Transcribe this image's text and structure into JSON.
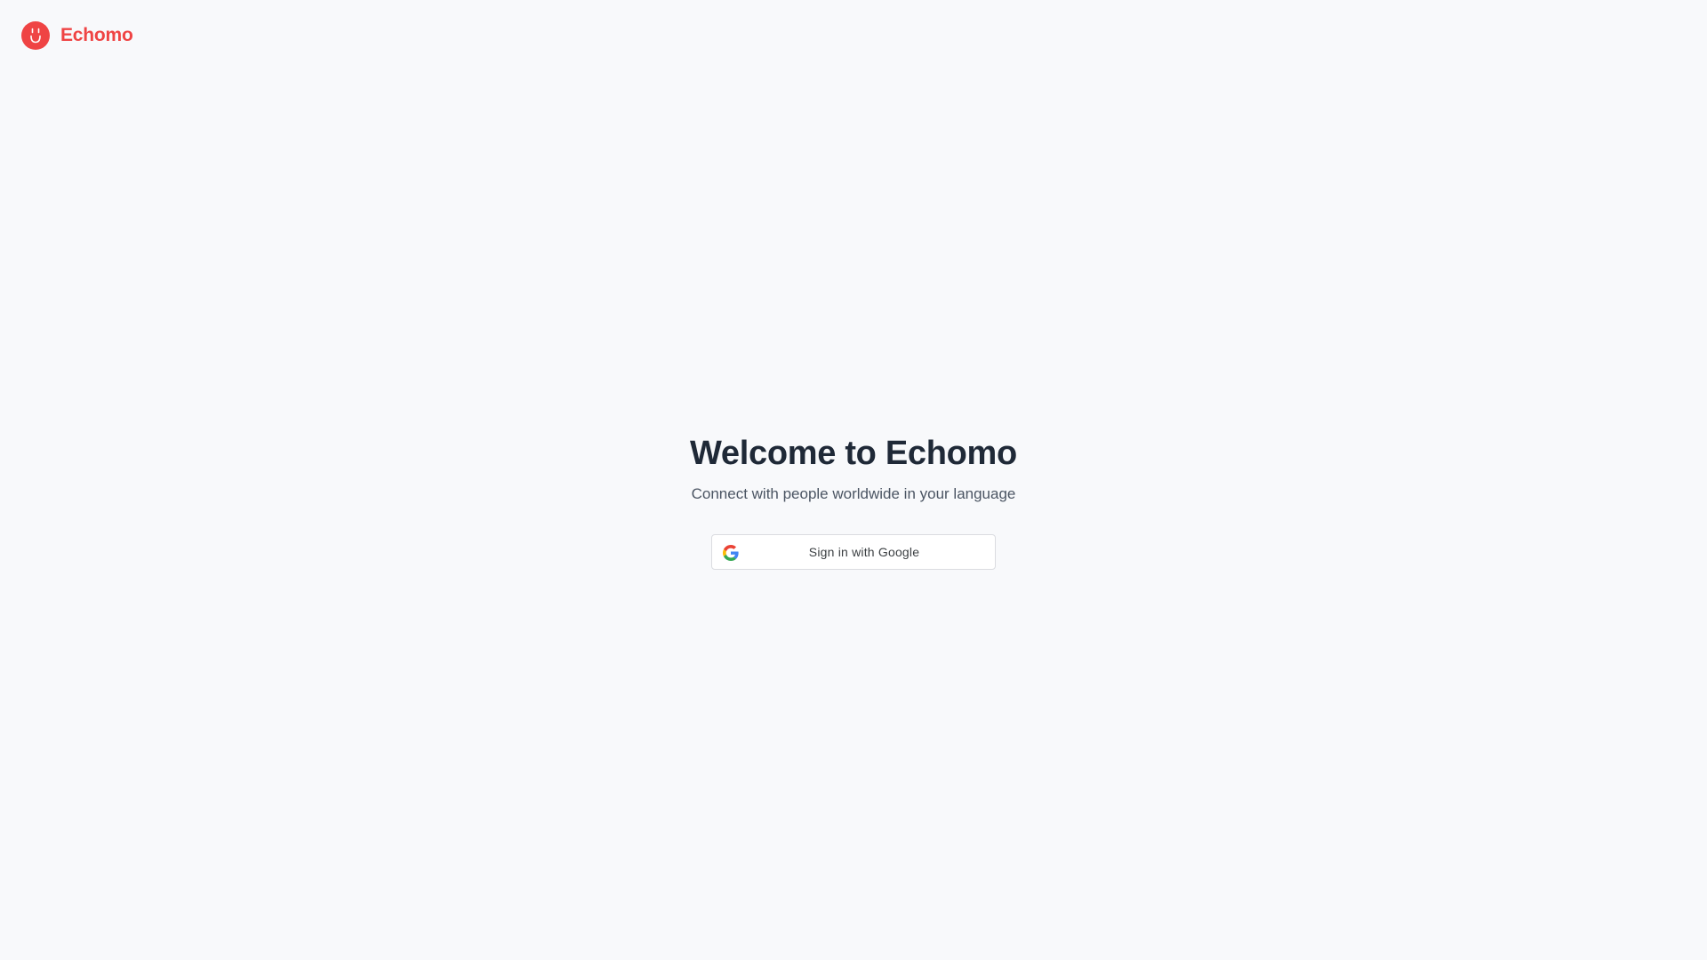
{
  "header": {
    "logo_icon": "smiley-face-icon",
    "brand_name": "Echomo",
    "brand_color": "#ef4444"
  },
  "hero": {
    "title": "Welcome to Echomo",
    "subtitle": "Connect with people worldwide in your language"
  },
  "signin": {
    "icon": "google-icon",
    "label": "Sign in with Google"
  },
  "colors": {
    "background": "#f8f9fb",
    "title": "#1f2937",
    "subtitle": "#4b5563",
    "button_border": "#dadce0"
  }
}
